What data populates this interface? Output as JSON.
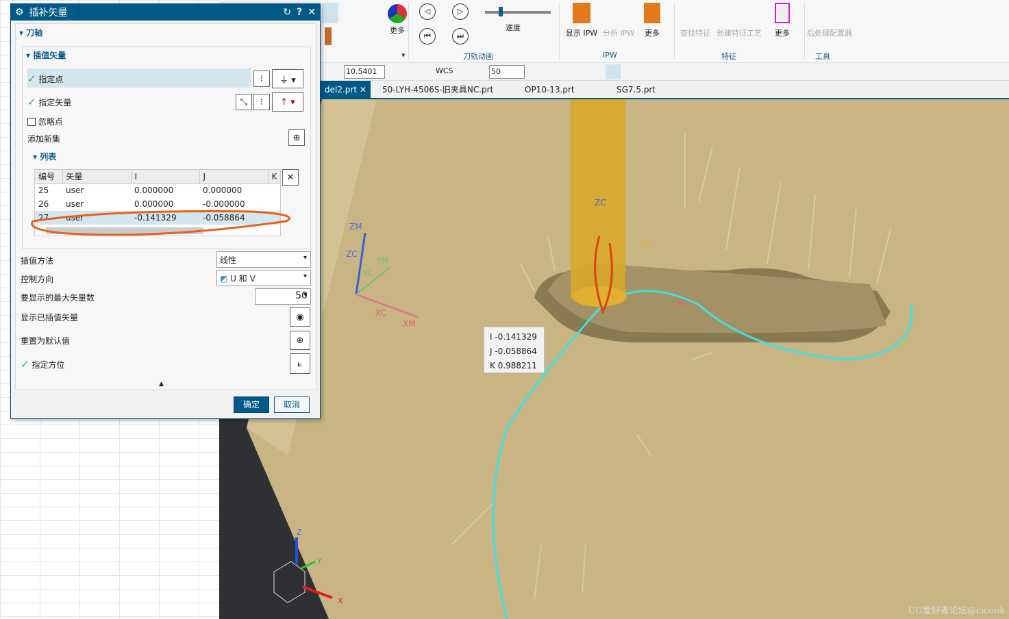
{
  "ribbon": {
    "more1": "更多",
    "speed": "速度",
    "group_anim": "刀轨动画",
    "show_ipw": "显示 IPW",
    "analyze_ipw": "分析 IPW",
    "more2": "更多",
    "group_ipw": "IPW",
    "find_feature": "查找特征",
    "create_feature_process": "创建特征工艺",
    "more3": "更多",
    "group_feature": "特征",
    "post_config": "后处理配置器",
    "group_tools": "工具",
    "speed_value": 0.22
  },
  "toolbar2": {
    "tolerance": "10.5401",
    "wcs": "WCS",
    "layer_value": "50"
  },
  "tabs": [
    {
      "label": "del2.prt"
    },
    {
      "label": "50-LYH-4506S-旧夹具NC.prt"
    },
    {
      "label": "OP10-13.prt"
    },
    {
      "label": "SG7.5.prt"
    }
  ],
  "dialog": {
    "title": "插补矢量",
    "section_axis": "刀轴",
    "section_interp": "插值矢量",
    "specify_point": "指定点",
    "specify_vector": "指定矢量",
    "ignore_point": "忽略点",
    "add_new_set": "添加新集",
    "section_list": "列表",
    "columns": [
      "编号",
      "矢量",
      "I",
      "J",
      "K"
    ],
    "rows": [
      {
        "id": "25",
        "vec": "user",
        "i": "0.000000",
        "j": "0.000000"
      },
      {
        "id": "26",
        "vec": "user",
        "i": "0.000000",
        "j": "-0.000000"
      },
      {
        "id": "27",
        "vec": "user",
        "i": "-0.141329",
        "j": "-0.058864"
      }
    ],
    "interp_method_label": "插值方法",
    "interp_method": "线性",
    "control_dir_label": "控制方向",
    "control_dir": "U 和 V",
    "max_vectors_label": "要显示的最大矢量数",
    "max_vectors": "50",
    "show_interp_label": "显示已插值矢量",
    "reset_label": "重置为默认值",
    "specify_orient": "指定方位",
    "ok": "确定",
    "cancel": "取消"
  },
  "tooltip": {
    "i": "I  -0.141329",
    "j": "J  -0.058864",
    "k": "K  0.988211"
  },
  "axes": {
    "zm": "ZM",
    "zc": "ZC",
    "ym": "YM",
    "yc": "YC",
    "xc": "XC",
    "xm": "XM",
    "z": "Z",
    "y": "Y",
    "x": "X"
  },
  "watermark": "UG爱好者论坛@cicook"
}
